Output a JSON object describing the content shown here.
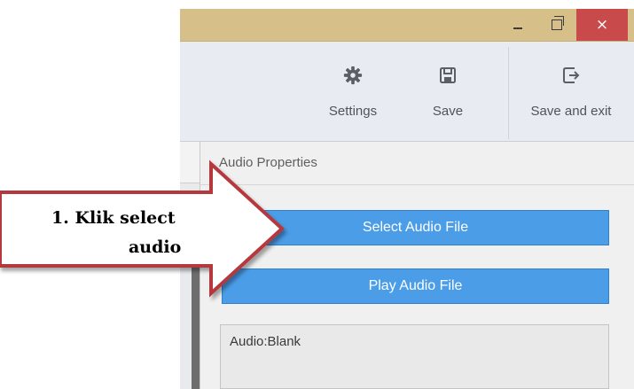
{
  "window": {
    "minimize_icon": "minimize-icon",
    "restore_icon": "restore-icon",
    "close_symbol": "×",
    "titlebar_color": "#d7bf8a",
    "close_color": "#c94a4a"
  },
  "toolbar": {
    "settings": {
      "label": "Settings",
      "icon": "gear-icon"
    },
    "save": {
      "label": "Save",
      "icon": "floppy-disk-icon"
    },
    "save_exit": {
      "label": "Save and exit",
      "icon": "exit-icon"
    }
  },
  "panel": {
    "title": "Audio Properties",
    "select_button": "Select Audio File",
    "play_button": "Play Audio File",
    "audio_status": "Audio:Blank",
    "button_color": "#4b9de8"
  },
  "callout": {
    "line1": "1. Klik select",
    "line2": "audio",
    "fill_color": "#ffffff",
    "border_color": "#b5373d"
  }
}
